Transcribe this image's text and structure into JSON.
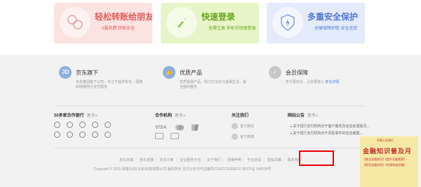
{
  "promos": [
    {
      "title": "轻松转账给朋友",
      "sub": "0服务费 转账安全",
      "icon": "people-icon",
      "color": "#e0605d"
    },
    {
      "title": "快速登录",
      "sub": "无需注册 手机号快速登录",
      "icon": "rocket-icon",
      "color": "#69a51c"
    },
    {
      "title": "多重安全保护",
      "sub": "全硬保障护航 安全无忧",
      "icon": "shield-icon",
      "color": "#4e7ad8"
    }
  ],
  "features": [
    {
      "icon_text": "JD",
      "title": "京东旗下",
      "desc": "京东集团旗下公司，专注于提供安全、便捷的网络电子支付服务"
    },
    {
      "icon_text": "👍",
      "title": "优质产品",
      "desc": "优质金融产品，助力打造多元金融生活，最全面的服务"
    },
    {
      "icon_text": "✓",
      "title": "会员保障",
      "desc": "支付更安全，让您更放心",
      "link": "安全详情"
    }
  ],
  "columns": {
    "banks": {
      "title": "50多家合作银行",
      "more": "更多»"
    },
    "partners": {
      "title": "合作机构",
      "more": "更多»",
      "logos": [
        "VISA",
        "MC",
        "UP"
      ]
    },
    "follow": {
      "title": "关注我们",
      "items": [
        "官方微信",
        "官方微博"
      ]
    },
    "notices": {
      "title": "网站公告",
      "more": "更多»",
      "items": [
        "关于招行支付机构对于客户服务及信息处理情况...",
        "关于招行支付机构对于风险事件的信息披露..."
      ]
    }
  },
  "footer_links": [
    "京东商城",
    "京东金融",
    "京东众筹",
    "企业服务平台",
    "关于我们",
    "法律声明",
    "平台协议",
    "隐私政策",
    "联系我们"
  ],
  "copyright": "Copyright © 2015 网银在线(北京)科技有限公司 版权所有 支付业务许可证编号Z2002211000010 京ICP证 040599号",
  "ad": {
    "logo": "中国人民银行",
    "title": "金融知识普及月",
    "lines": [
      "【普及金融知识】【提升金融素养】",
      "【防范金融风险】【共建和谐金融】"
    ]
  }
}
